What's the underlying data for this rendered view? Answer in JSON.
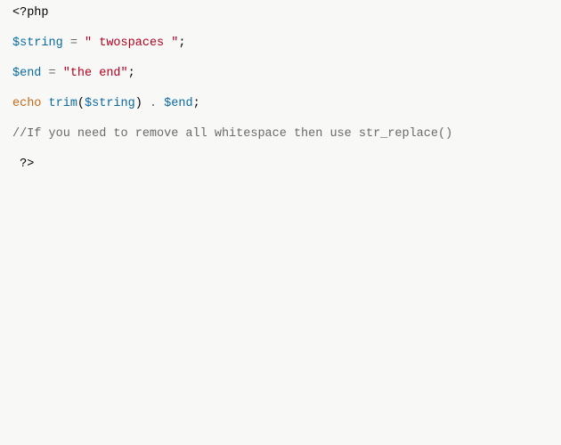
{
  "open_tag": "<?php",
  "line2": {
    "var": "$string",
    "assign": " = ",
    "str": "\" twospaces \"",
    "semi": ";"
  },
  "line3": {
    "var": "$end",
    "assign": " = ",
    "str": "\"the end\"",
    "semi": ";"
  },
  "line4": {
    "echo": "echo",
    "sp1": " ",
    "func": "trim",
    "lp": "(",
    "arg": "$string",
    "rp": ")",
    "concat": " . ",
    "end_var": "$end",
    "semi": ";"
  },
  "comment": "//If you need to remove all whitespace then use str_replace()",
  "close_prefix": " ",
  "close_tag": "?>"
}
